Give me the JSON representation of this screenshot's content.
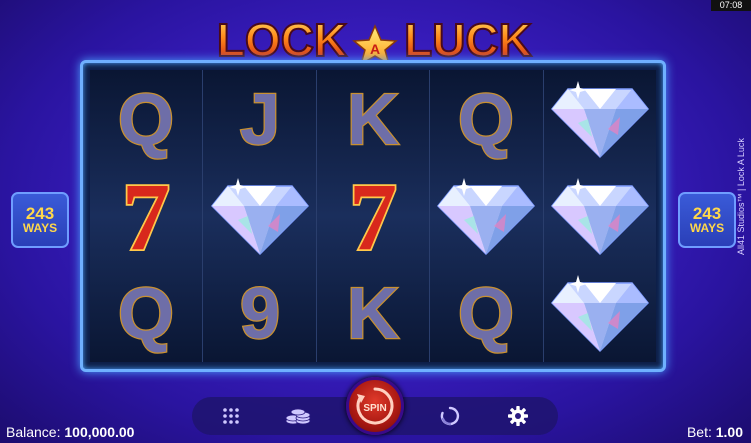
{
  "status_bar": {
    "time": "07:08"
  },
  "logo": {
    "word1": "LOCK",
    "middle": "A",
    "word2": "LUCK"
  },
  "ways": {
    "number": "243",
    "label": "WAYS"
  },
  "studio_text": "All41 Studios™ | Lock A Luck",
  "reels": [
    [
      "Q",
      "7",
      "Q"
    ],
    [
      "J",
      "diamond",
      "9"
    ],
    [
      "K",
      "7",
      "K"
    ],
    [
      "Q",
      "diamond",
      "Q"
    ],
    [
      "diamond",
      "diamond",
      "diamond"
    ]
  ],
  "toolbar": {
    "menu_icon": "grid-icon",
    "coins_icon": "coins-icon",
    "spin_label": "SPIN",
    "autoplay_icon": "autoplay-icon",
    "settings_icon": "gear-icon"
  },
  "footer": {
    "balance_label": "Balance:",
    "balance_value": "100,000.00",
    "bet_label": "Bet:",
    "bet_value": "1.00"
  },
  "colors": {
    "background": "#3d1fc7",
    "frame_border": "#6fb0ff",
    "ways_text": "#ffd84a",
    "spin_button": "#c8221a",
    "letter_symbol": "#6e6ea8",
    "seven_symbol": "#d8281c"
  }
}
